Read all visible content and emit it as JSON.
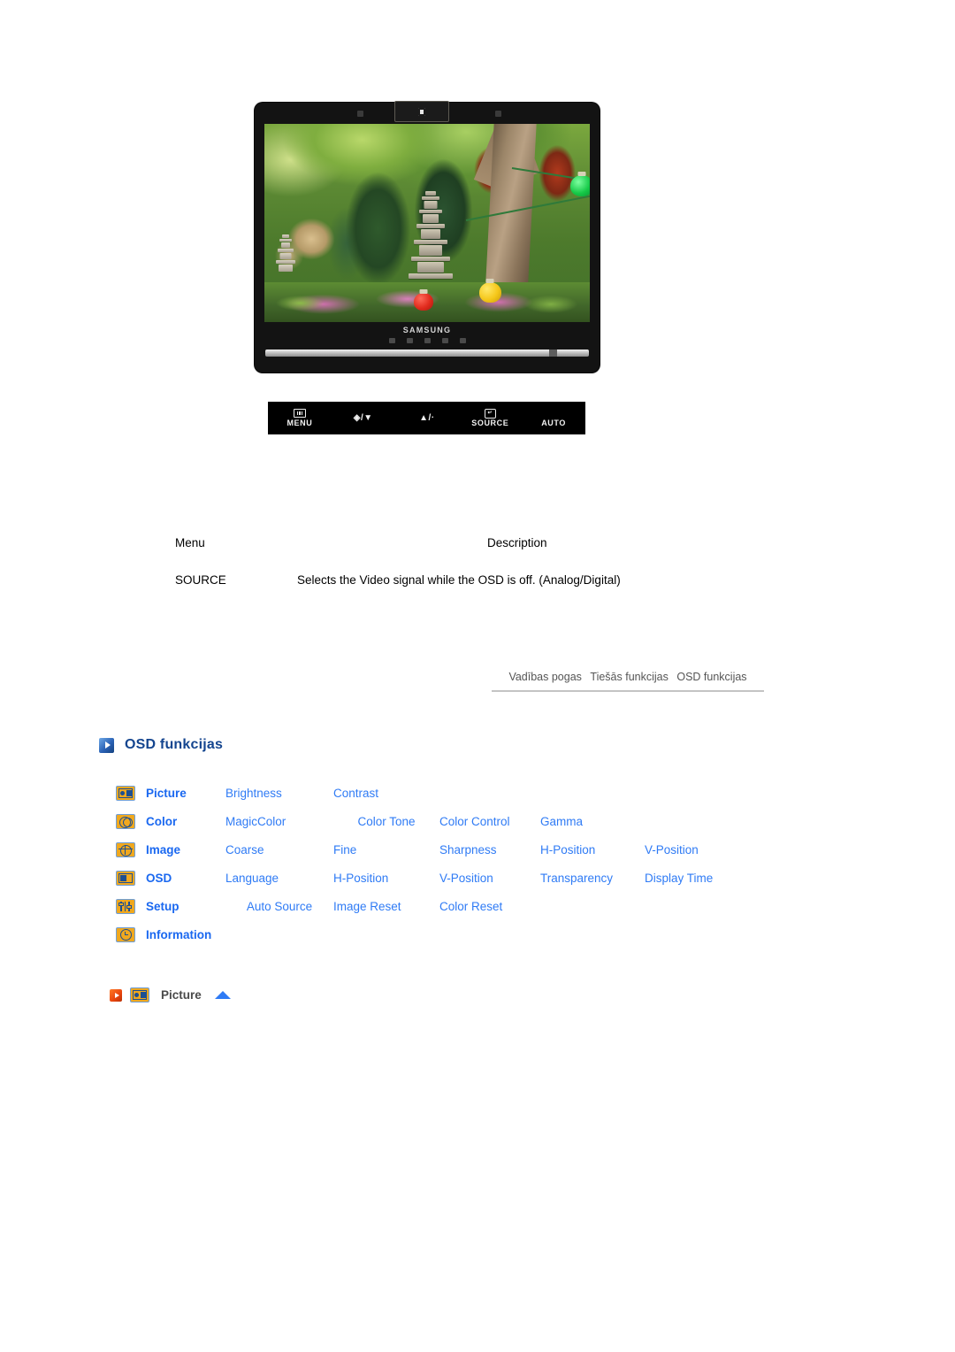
{
  "device": {
    "brand": "SAMSUNG",
    "control_buttons": [
      {
        "icon": "menu-icon",
        "label": "MENU"
      },
      {
        "icon": "brightness-down-icon",
        "label": "",
        "glyph": "◈/▼"
      },
      {
        "icon": "volume-up-icon",
        "label": "",
        "glyph": "▲/ᐧ"
      },
      {
        "icon": "source-icon",
        "label": "SOURCE"
      },
      {
        "icon": "auto-icon",
        "label": "AUTO"
      }
    ]
  },
  "description_table": {
    "headers": {
      "menu": "Menu",
      "description": "Description"
    },
    "rows": [
      {
        "menu": "SOURCE",
        "description": "Selects the Video signal while the OSD is off. (Analog/Digital)"
      }
    ]
  },
  "breadcrumb": {
    "items": [
      "Vadības pogas",
      "Tiešās funkcijas",
      "OSD funkcijas"
    ]
  },
  "section": {
    "icon": "blue-play-icon",
    "title": "OSD funkcijas"
  },
  "osd_menu": {
    "rows": [
      {
        "icon": "picture-icon",
        "name": "Picture",
        "items": [
          "Brightness",
          "Contrast"
        ]
      },
      {
        "icon": "color-icon",
        "name": "Color",
        "items": [
          "MagicColor",
          "Color Tone",
          "Color Control",
          "Gamma"
        ]
      },
      {
        "icon": "image-icon",
        "name": "Image",
        "items": [
          "Coarse",
          "Fine",
          "Sharpness",
          "H-Position",
          "V-Position"
        ]
      },
      {
        "icon": "osd-icon",
        "name": "OSD",
        "items": [
          "Language",
          "H-Position",
          "V-Position",
          "Transparency",
          "Display Time"
        ]
      },
      {
        "icon": "setup-icon",
        "name": "Setup",
        "items": [
          "Auto Source",
          "Image Reset",
          "Color Reset"
        ]
      },
      {
        "icon": "information-icon",
        "name": "Information",
        "items": []
      }
    ]
  },
  "subsection": {
    "arrow_icon": "orange-play-icon",
    "menu_icon": "picture-icon",
    "label": "Picture",
    "collapse_icon": "blue-up-triangle-icon"
  },
  "colors": {
    "link_blue": "#2f7bf5",
    "heading_blue": "#14458f",
    "bold_blue": "#1a68f0",
    "icon_orange": "#f0a81e",
    "icon_border_blue": "#6f9fd8",
    "accent_orange": "#e8440d"
  }
}
